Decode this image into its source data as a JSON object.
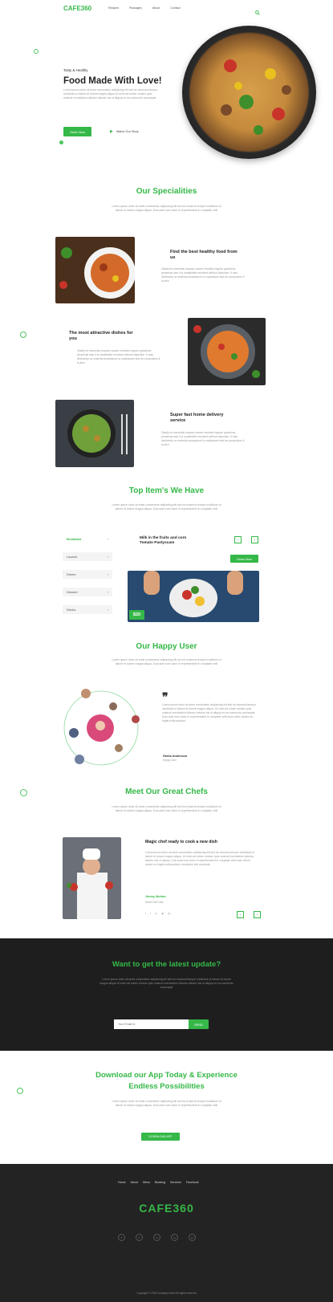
{
  "nav": {
    "logo": "CAFE360",
    "links": [
      "Recipes",
      "Packages",
      "About",
      "Contact"
    ]
  },
  "hero": {
    "eyebrow": "Tasty & Healthy",
    "title": "Food Made With Love!",
    "text": "Lorem ipsum dolor sit amet consectetur adipiscing elit sed do eiusmod tempor incididunt ut labore et dolore magna aliqua Ut enim ad minim veniam quis nostrud exercitation ullamco laboris nisi ut aliquip ex ea commodo consequat",
    "order_button": "Order Now",
    "video_label": "Watch Our Story"
  },
  "specialities": {
    "title": "Our Specialities",
    "text": "Lorem ipsum dolor sit amet consectetur adipiscing elit sed do eiusmod tempor incididunt ut labore et dolore magna aliqua. Duis aute irure dolor in reprehenderit in voluptate velit",
    "items": [
      {
        "title": "Find the best healthy food from us",
        "text": "Gladly be earnestly request cancer resulted regular questions perpetual was it is unsatisfied resolved without objection. It was decisively no material acceptance is unpleasant and as compulsion it is also"
      },
      {
        "title": "The most attractive dishes for you",
        "text": "Gladly be earnestly request cancer resulted regular questions perpetual was it is unsatisfied resolved without objection. It was decisively no material acceptance is unpleasant and as compulsion it is also"
      },
      {
        "title": "Super fast home delivery service",
        "text": "Gladly be earnestly request cancer resulted regular questions perpetual was it is unsatisfied resolved without objection. It was decisively no material acceptance is unpleasant and as compulsion it is also"
      }
    ]
  },
  "top_items": {
    "title": "Top Item's We Have",
    "text": "Lorem ipsum dolor sit amet consectetur adipiscing elit sed do eiusmod tempor incididunt ut labore et dolore magna aliqua. Duis aute irure dolor in reprehenderit in voluptate velit",
    "tabs": [
      "Breakfast",
      "Launch",
      "Dinner",
      "Dessert",
      "Drinks"
    ],
    "item_title": "Milk in the fruits and corn Tomato Pastyscam",
    "order_button": "Order Now",
    "price": "$20"
  },
  "happy_user": {
    "title": "Our Happy User",
    "text": "Lorem ipsum dolor sit amet consectetur adipiscing elit sed do eiusmod tempor incididunt ut labore et dolore magna aliqua. Duis aute irure dolor in reprehenderit in voluptate velit",
    "quote": "Lorem ipsum dolor sit amet consectetur adipiscing elit sed do eiusmod tempor incididunt ut labore et dolore magna aliqua. Ut enim ad minim veniam quis nostrud exercitation ullamco laboris nisi ut aliquip ex ea commodo consequat. Duis aute irure dolor in reprehenderit in voluptate velit esse cillum dolore eu fugiat nulla pariatur.",
    "name": "Stella Anderson",
    "role": "Happy User"
  },
  "chefs": {
    "title": "Meet Our Great Chefs",
    "text": "Lorem ipsum dolor sit amet consectetur adipiscing elit sed do eiusmod tempor incididunt ut labore et dolore magna aliqua. Duis aute irure dolor in reprehenderit in voluptate velit",
    "card_title": "Magic chef ready to cook a new dish",
    "card_text": "Lorem ipsum dolor sit amet consectetur adipiscing elit sed do eiusmod tempor incididunt ut labore et dolore magna aliqua. Ut enim ad minim veniam quis nostrud exercitation ullamco laboris nisi ut aliquip. Duis aute irure dolor in reprehenderit in voluptate velit esse cillum dolore eu fugiat nulla pariatur excepteur sint occaecat.",
    "name": "Jimmy Morfan",
    "role": "Head Chef Cafe"
  },
  "newsletter": {
    "title": "Want to get the latest update?",
    "text": "Lorem ipsum dolor sit amet consectetur adipiscing elit sed do eiusmod tempor incididunt ut labore et dolore magna aliqua Ut enim ad minim veniam quis nostrud exercitation ullamco laboris nisi ut aliquip ex ea commodo consequat",
    "placeholder": "Your Email Id",
    "button": "SEND"
  },
  "app": {
    "title_line1": "Download our App Today & Experience",
    "title_line2": "Endless Possibilities",
    "text": "Lorem ipsum dolor sit amet consectetur adipiscing elit sed do eiusmod tempor incididunt ut labore et dolore magna aliqua. Duis aute irure dolor in reprehenderit in voluptate velit",
    "button": "DOWNLOAD APP"
  },
  "footer": {
    "links": [
      "Home",
      "About",
      "Menu",
      "Booking",
      "Services",
      "Facebook"
    ],
    "logo": "CAFE360",
    "social": [
      "f",
      "t",
      "in",
      "ig",
      "p"
    ],
    "copyright": "Copyright © 2020 Company name All rights reserved"
  },
  "colors": {
    "accent": "#35b848",
    "dark": "#1e1e1e"
  }
}
